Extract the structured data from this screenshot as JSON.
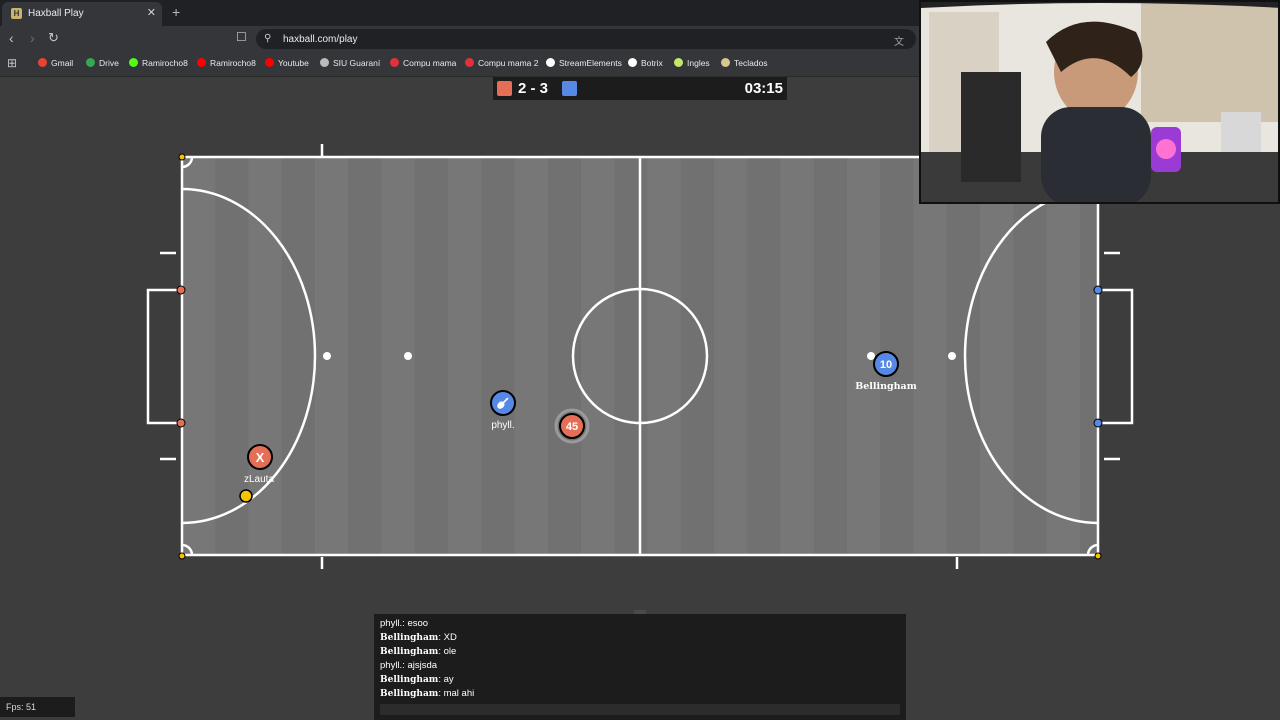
{
  "browser": {
    "tab_title": "Haxball Play",
    "tab_favicon_letter": "H",
    "url": "haxball.com/play",
    "bookmarks": [
      {
        "label": "Gmail",
        "color": "#ea4335"
      },
      {
        "label": "Drive",
        "color": "#34a853"
      },
      {
        "label": "Ramirocho8",
        "color": "#53fc18"
      },
      {
        "label": "Ramirocho8",
        "color": "#ff0000"
      },
      {
        "label": "Youtube",
        "color": "#ff0000"
      },
      {
        "label": "SIU Guaraní",
        "color": "#bbbbbb"
      },
      {
        "label": "Compu mama",
        "color": "#e0323c"
      },
      {
        "label": "Compu mama 2",
        "color": "#e0323c"
      },
      {
        "label": "StreamElements",
        "color": "#ffffff"
      },
      {
        "label": "Botrix",
        "color": "#ffffff"
      },
      {
        "label": "Ingles",
        "color": "#c6e86a"
      },
      {
        "label": "Teclados",
        "color": "#d8c68e"
      }
    ]
  },
  "scoreboard": {
    "score": "2 - 3",
    "time": "03:15",
    "red_color": "#e56e56",
    "blue_color": "#5689e5"
  },
  "players": [
    {
      "name": "zLauta",
      "avatar": "X",
      "team": "red"
    },
    {
      "name": "phyll.",
      "avatar": "guitar-icon",
      "team": "blue"
    },
    {
      "name": "",
      "avatar": "45",
      "team": "red"
    },
    {
      "name": "Bellingham",
      "avatar": "10",
      "team": "blue"
    }
  ],
  "chat": {
    "messages": [
      {
        "author": "phyll.",
        "text": "esoo"
      },
      {
        "author": "Bellingham",
        "text": "XD"
      },
      {
        "author": "Bellingham",
        "text": "ole"
      },
      {
        "author": "phyll.",
        "text": "ajsjsda"
      },
      {
        "author": "Bellingham",
        "text": "ay"
      },
      {
        "author": "Bellingham",
        "text": "mal ahi"
      }
    ]
  },
  "fps": "Fps: 51"
}
